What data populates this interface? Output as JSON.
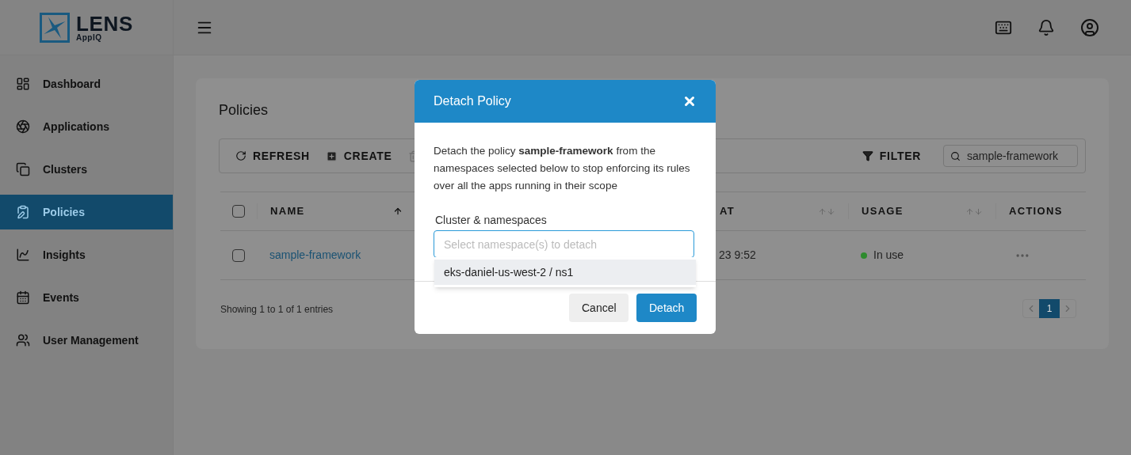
{
  "logo": {
    "name": "LENS",
    "sub": "AppIQ"
  },
  "sidebar": {
    "items": [
      {
        "label": "Dashboard",
        "selected": false
      },
      {
        "label": "Applications",
        "selected": false
      },
      {
        "label": "Clusters",
        "selected": false
      },
      {
        "label": "Policies",
        "selected": true
      },
      {
        "label": "Insights",
        "selected": false
      },
      {
        "label": "Events",
        "selected": false
      },
      {
        "label": "User Management",
        "selected": false
      }
    ]
  },
  "page": {
    "title": "Policies",
    "toolbar": [
      {
        "kind": "refresh",
        "label": "REFRESH"
      },
      {
        "kind": "create",
        "label": "CREATE"
      }
    ],
    "filter": "FILTER",
    "search": {
      "value": "sample-framework"
    }
  },
  "table": {
    "select_all_checked": false,
    "columns": [
      {
        "label": "NAME",
        "sortable": true,
        "sorted_ascending": true
      },
      {
        "label": "AT",
        "sortable": true,
        "sorted_ascending": false
      },
      {
        "label": "USAGE",
        "sortable": true,
        "sorted_ascending": false
      },
      {
        "label": "ACTIONS"
      }
    ],
    "rows": [
      {
        "checked": false,
        "name": "sample-framework",
        "column_3": "23 9:52",
        "usage": "In use",
        "color": "#2e8b2e"
      }
    ],
    "footer": "Showing 1 to 1 of 1 entries",
    "pages": [
      {
        "label": "1",
        "selected": true
      }
    ]
  },
  "dialog": {
    "title": "Detach Policy",
    "message": "Detach the policy **sample-framework** from the namespaces selected below to stop enforcing its rules over all the apps running in their scope",
    "field_label": "Cluster & namespaces",
    "placeholder": "Select namespace(s) to detach",
    "options": [
      "eks-daniel-us-west-2 / ns1"
    ],
    "buttons": [
      {
        "kind": "secondary",
        "label": "Cancel"
      },
      {
        "kind": "primary",
        "label": "Detach"
      }
    ]
  }
}
